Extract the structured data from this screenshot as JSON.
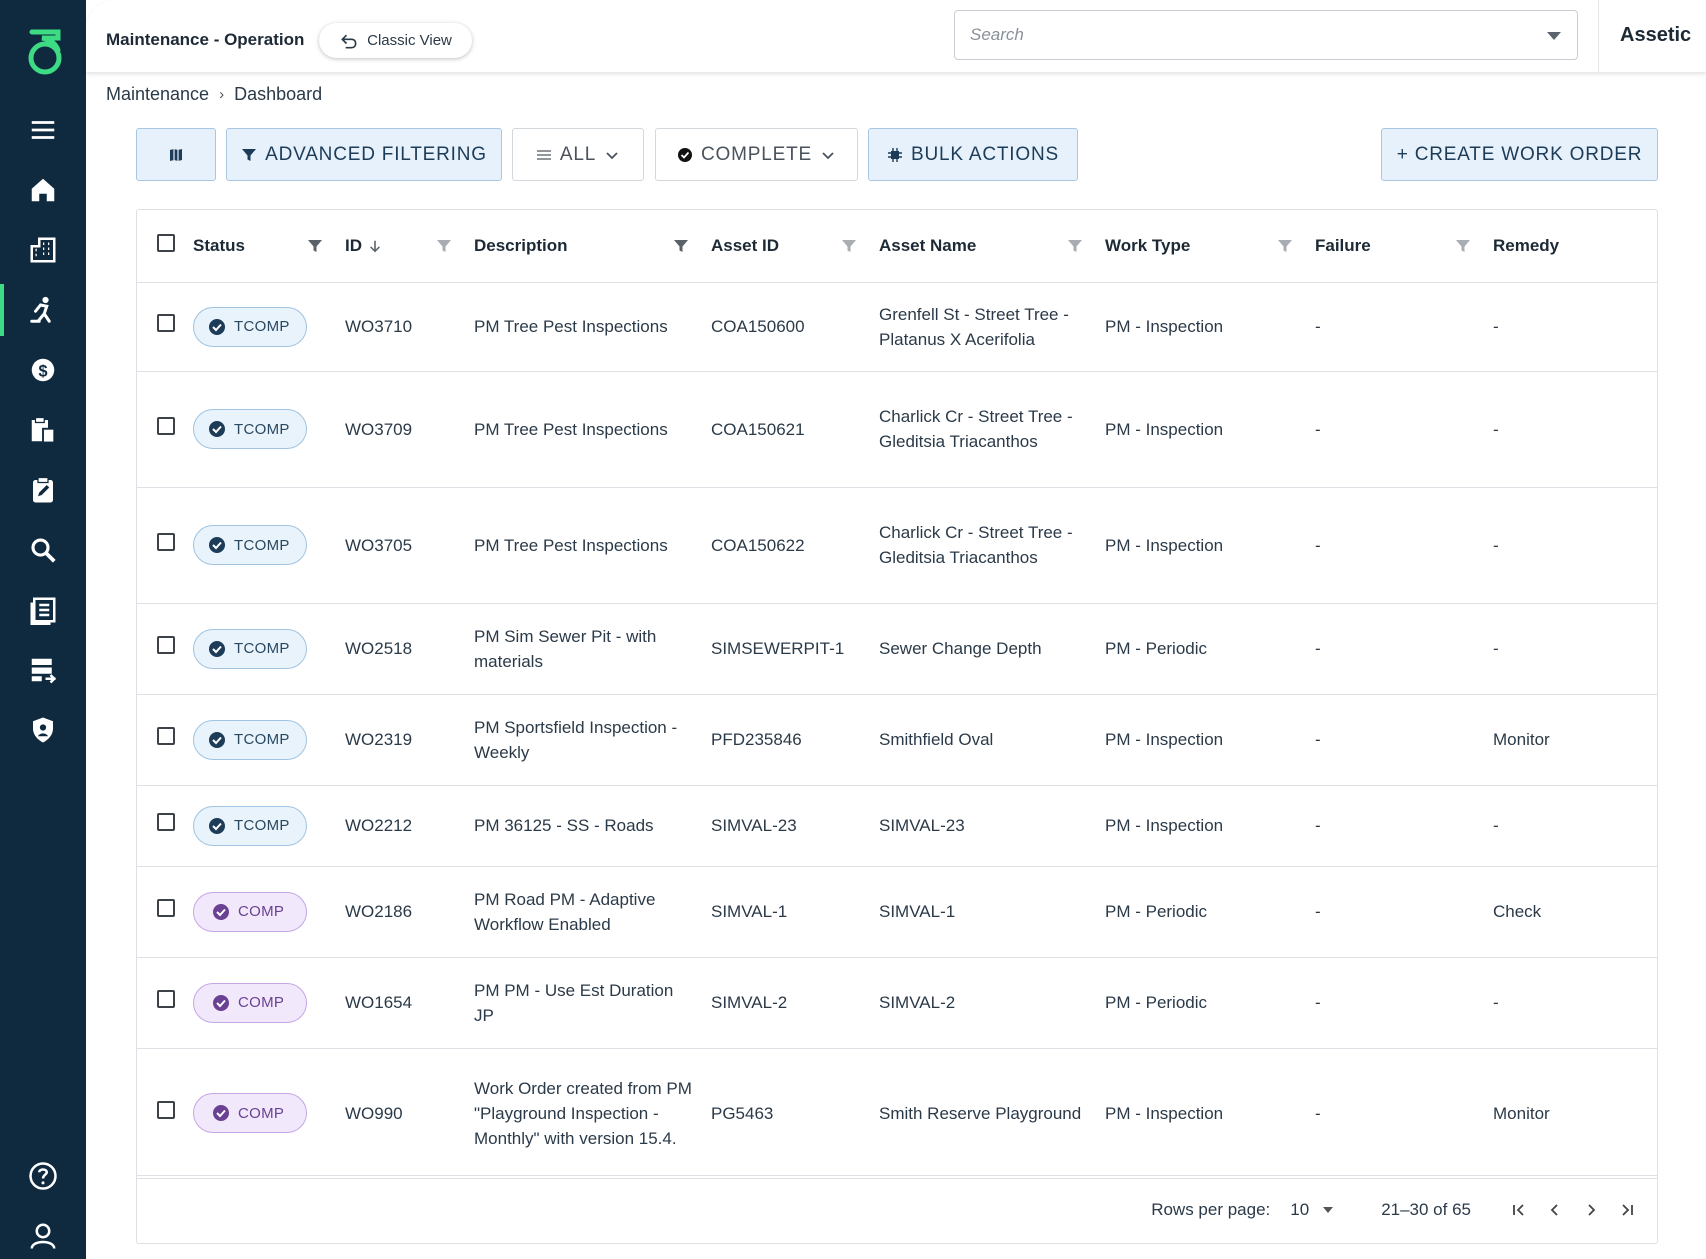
{
  "header": {
    "app_title": "Maintenance - Operation",
    "classic_view_label": "Classic View",
    "search_placeholder": "Search",
    "brand": "Assetic"
  },
  "breadcrumb": {
    "root": "Maintenance",
    "current": "Dashboard",
    "separator": "›"
  },
  "toolbar": {
    "map_icon": "map-icon",
    "advanced_filtering": "ADVANCED FILTERING",
    "all_label": "ALL",
    "complete_label": "COMPLETE",
    "bulk_actions": "BULK ACTIONS",
    "create_work_order": "+ CREATE WORK ORDER"
  },
  "sidebar": {
    "items": [
      "menu-icon",
      "home-icon",
      "buildings-icon",
      "worker-icon",
      "finance-icon",
      "clipboard-building-icon",
      "edit-clipboard-icon",
      "search-icon",
      "document-list-icon",
      "list-edit-icon",
      "shield-icon",
      "help-icon",
      "user-icon"
    ],
    "active": "worker-icon",
    "accent_color": "#3ddc84",
    "bg_color": "#0f2a3f"
  },
  "table": {
    "columns": [
      "Status",
      "ID",
      "Description",
      "Asset ID",
      "Asset Name",
      "Work Type",
      "Failure",
      "Remedy"
    ],
    "rows": [
      {
        "status": "TCOMP",
        "id": "WO3710",
        "description": "PM Tree Pest Inspections",
        "asset_id": "COA150600",
        "asset_name": "Grenfell St - Street Tree - Platanus X Acerifolia",
        "work_type": "PM - Inspection",
        "failure": "-",
        "remedy": "-"
      },
      {
        "status": "TCOMP",
        "id": "WO3709",
        "description": "PM Tree Pest Inspections",
        "asset_id": "COA150621",
        "asset_name": "Charlick Cr - Street Tree - Gleditsia Triacanthos",
        "work_type": "PM - Inspection",
        "failure": "-",
        "remedy": "-"
      },
      {
        "status": "TCOMP",
        "id": "WO3705",
        "description": "PM Tree Pest Inspections",
        "asset_id": "COA150622",
        "asset_name": "Charlick Cr - Street Tree - Gleditsia Triacanthos",
        "work_type": "PM - Inspection",
        "failure": "-",
        "remedy": "-"
      },
      {
        "status": "TCOMP",
        "id": "WO2518",
        "description": "PM Sim Sewer Pit - with materials",
        "asset_id": "SIMSEWERPIT-1",
        "asset_name": "Sewer Change Depth",
        "work_type": "PM - Periodic",
        "failure": "-",
        "remedy": "-"
      },
      {
        "status": "TCOMP",
        "id": "WO2319",
        "description": "PM Sportsfield Inspection - Weekly",
        "asset_id": "PFD235846",
        "asset_name": "Smithfield Oval",
        "work_type": "PM - Inspection",
        "failure": "-",
        "remedy": "Monitor"
      },
      {
        "status": "TCOMP",
        "id": "WO2212",
        "description": "PM 36125 - SS - Roads",
        "asset_id": "SIMVAL-23",
        "asset_name": "SIMVAL-23",
        "work_type": "PM - Inspection",
        "failure": "-",
        "remedy": "-"
      },
      {
        "status": "COMP",
        "id": "WO2186",
        "description": "PM Road PM - Adaptive Workflow Enabled",
        "asset_id": "SIMVAL-1",
        "asset_name": "SIMVAL-1",
        "work_type": "PM - Periodic",
        "failure": "-",
        "remedy": "Check"
      },
      {
        "status": "COMP",
        "id": "WO1654",
        "description": "PM PM - Use Est Duration JP",
        "asset_id": "SIMVAL-2",
        "asset_name": "SIMVAL-2",
        "work_type": "PM - Periodic",
        "failure": "-",
        "remedy": "-"
      },
      {
        "status": "COMP",
        "id": "WO990",
        "description": "Work Order created from PM \"Playground Inspection - Monthly\" with version 15.4.",
        "asset_id": "PG5463",
        "asset_name": "Smith Reserve Playground",
        "work_type": "PM - Inspection",
        "failure": "-",
        "remedy": "Monitor"
      }
    ]
  },
  "pagination": {
    "rows_per_page_label": "Rows per page:",
    "rows_per_page": "10",
    "range": "21–30 of 65"
  }
}
